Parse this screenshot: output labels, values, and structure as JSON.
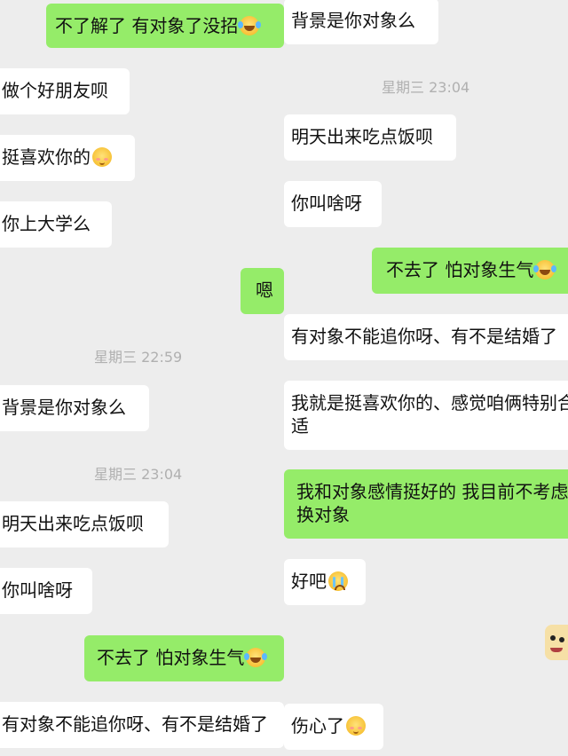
{
  "left": {
    "messages": [
      {
        "text": "不了解了 有对象了没招",
        "emoji": "laughing-crying-emoji",
        "side": "out"
      },
      {
        "text": "做个好朋友呗",
        "side": "in"
      },
      {
        "text": "挺喜欢你的",
        "emoji": "blushing-smile-emoji",
        "side": "in"
      },
      {
        "text": "你上大学么",
        "side": "in"
      },
      {
        "text": "嗯",
        "side": "out"
      },
      {
        "timestamp": "星期三 22:59"
      },
      {
        "text": "背景是你对象么",
        "side": "in"
      },
      {
        "timestamp": "星期三 23:04"
      },
      {
        "text": "明天出来吃点饭呗",
        "side": "in"
      },
      {
        "text": "你叫啥呀",
        "side": "in"
      },
      {
        "text": "不去了 怕对象生气",
        "emoji": "laughing-crying-emoji",
        "side": "out"
      },
      {
        "text": "有对象不能追你呀、有不是结婚了",
        "side": "in"
      }
    ]
  },
  "right": {
    "messages": [
      {
        "text": "背景是你对象么",
        "side": "in"
      },
      {
        "timestamp": "星期三 23:04"
      },
      {
        "text": "明天出来吃点饭呗",
        "side": "in"
      },
      {
        "text": "你叫啥呀",
        "side": "in"
      },
      {
        "text": "不去了 怕对象生气",
        "emoji": "laughing-crying-emoji",
        "side": "out"
      },
      {
        "text": "有对象不能追你呀、有不是结婚了",
        "side": "in"
      },
      {
        "text": "我就是挺喜欢你的、感觉咱俩特别合适",
        "side": "in"
      },
      {
        "text": "我和对象感情挺好的 我目前不考虑换对象",
        "side": "out"
      },
      {
        "text": "好吧",
        "emoji": "crying-emoji",
        "side": "in"
      },
      {
        "sticker": "cat-face-sticker"
      },
      {
        "text": "伤心了",
        "emoji": "blushing-smile-emoji",
        "side": "in"
      }
    ]
  },
  "colors": {
    "background": "#ededed",
    "incoming_bubble": "#ffffff",
    "outgoing_bubble": "#95ec69",
    "timestamp_text": "#b0b0b0"
  }
}
